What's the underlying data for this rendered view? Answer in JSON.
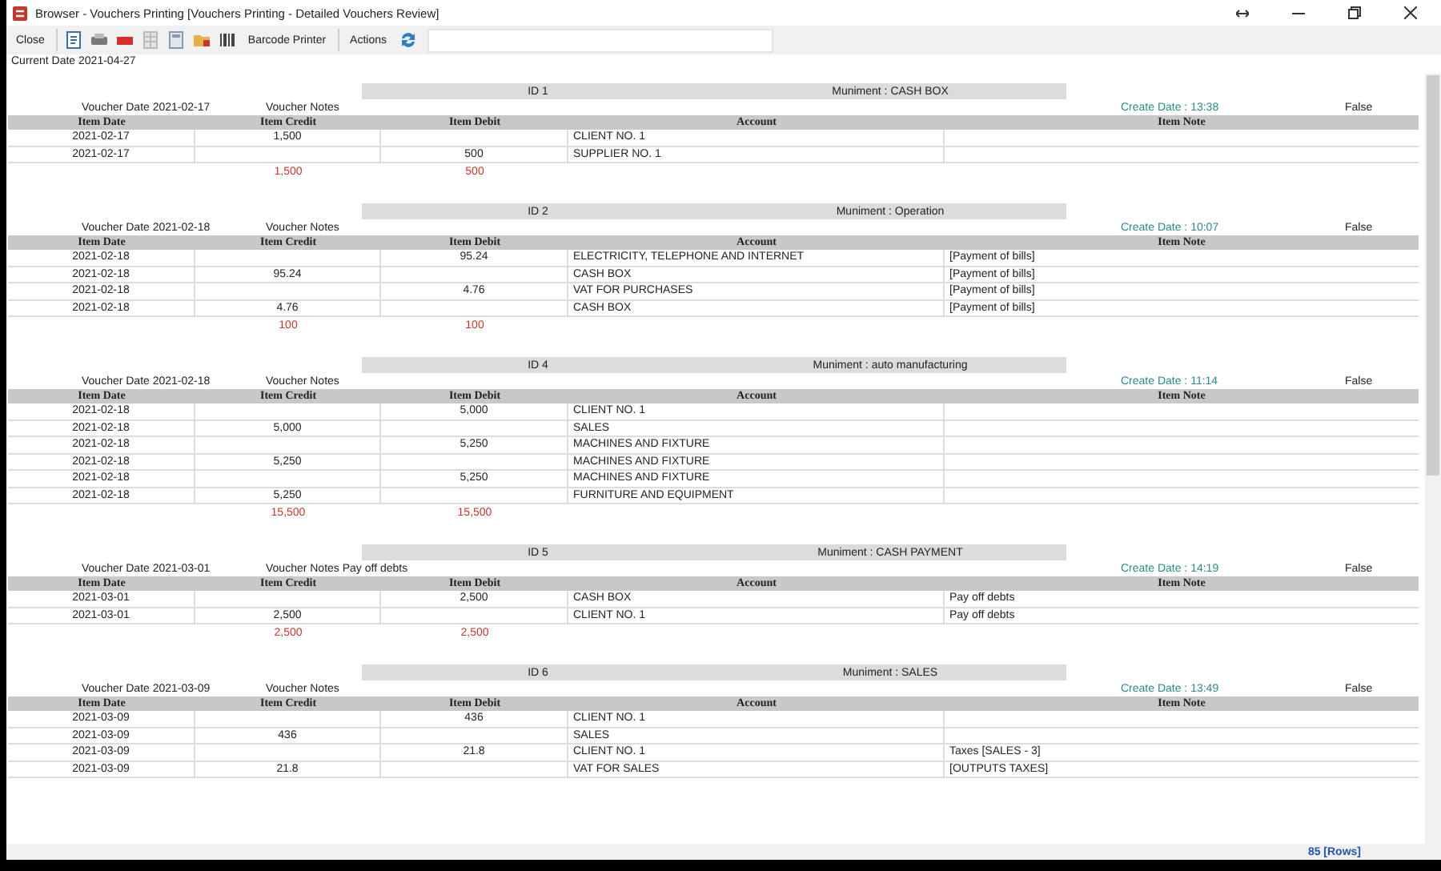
{
  "window": {
    "title": "Browser - Vouchers Printing [Vouchers Printing - Detailed Vouchers Review]"
  },
  "toolbar": {
    "close": "Close",
    "barcode": "Barcode Printer",
    "actions": "Actions"
  },
  "current_date": "Current Date 2021-04-27",
  "vouchers": [
    {
      "id": "ID 1",
      "muniment": "Muniment : CASH BOX",
      "voucher_date": "Voucher Date 2021-02-17",
      "notes": "Voucher Notes",
      "create_date": "Create Date : 13:38",
      "flag": "False",
      "columns": [
        "Item Date",
        "Item Credit",
        "Item Debit",
        "Account",
        "Item Note"
      ],
      "rows": [
        {
          "date": "2021-02-17",
          "credit": "1,500",
          "account": "CLIENT NO. 1"
        },
        {
          "date": "2021-02-17",
          "debit": "500",
          "account": "SUPPLIER NO. 1"
        }
      ],
      "totals": {
        "credit": "1,500",
        "debit": "500"
      }
    },
    {
      "id": "ID 2",
      "muniment": "Muniment : Operation",
      "voucher_date": "Voucher Date 2021-02-18",
      "notes": "Voucher Notes",
      "create_date": "Create Date : 10:07",
      "flag": "False",
      "columns": [
        "Item Date",
        "Item Credit",
        "Item Debit",
        "Account",
        "Item Note"
      ],
      "rows": [
        {
          "date": "2021-02-18",
          "debit": "95.24",
          "account": "ELECTRICITY, TELEPHONE AND INTERNET",
          "note": "[Payment of bills]"
        },
        {
          "date": "2021-02-18",
          "credit": "95.24",
          "account": "CASH BOX",
          "note": "[Payment of bills]"
        },
        {
          "date": "2021-02-18",
          "debit": "4.76",
          "account": "VAT FOR PURCHASES",
          "note": "[Payment of bills]"
        },
        {
          "date": "2021-02-18",
          "credit": "4.76",
          "account": "CASH BOX",
          "note": "[Payment of bills]"
        }
      ],
      "totals": {
        "credit": "100",
        "debit": "100"
      }
    },
    {
      "id": "ID 4",
      "muniment": "Muniment : auto manufacturing",
      "voucher_date": "Voucher Date 2021-02-18",
      "notes": "Voucher Notes",
      "create_date": "Create Date : 11:14",
      "flag": "False",
      "columns": [
        "Item Date",
        "Item Credit",
        "Item Debit",
        "Account",
        "Item Note"
      ],
      "rows": [
        {
          "date": "2021-02-18",
          "debit": "5,000",
          "account": "CLIENT NO. 1"
        },
        {
          "date": "2021-02-18",
          "credit": "5,000",
          "account": "SALES"
        },
        {
          "date": "2021-02-18",
          "debit": "5,250",
          "account": "MACHINES AND FIXTURE"
        },
        {
          "date": "2021-02-18",
          "credit": "5,250",
          "account": "MACHINES AND FIXTURE"
        },
        {
          "date": "2021-02-18",
          "debit": "5,250",
          "account": "MACHINES AND FIXTURE"
        },
        {
          "date": "2021-02-18",
          "credit": "5,250",
          "account": "FURNITURE AND EQUIPMENT"
        }
      ],
      "totals": {
        "credit": "15,500",
        "debit": "15,500"
      }
    },
    {
      "id": "ID 5",
      "muniment": "Muniment : CASH PAYMENT",
      "voucher_date": "Voucher Date 2021-03-01",
      "notes": "Voucher Notes Pay off debts",
      "create_date": "Create Date : 14:19",
      "flag": "False",
      "columns": [
        "Item Date",
        "Item Credit",
        "Item Debit",
        "Account",
        "Item Note"
      ],
      "rows": [
        {
          "date": "2021-03-01",
          "debit": "2,500",
          "account": "CASH BOX",
          "note": "Pay off debts"
        },
        {
          "date": "2021-03-01",
          "credit": "2,500",
          "account": "CLIENT NO. 1",
          "note": "Pay off debts"
        }
      ],
      "totals": {
        "credit": "2,500",
        "debit": "2,500"
      }
    },
    {
      "id": "ID 6",
      "muniment": "Muniment : SALES",
      "voucher_date": "Voucher Date 2021-03-09",
      "notes": "Voucher Notes",
      "create_date": "Create Date : 13:49",
      "flag": "False",
      "columns": [
        "Item Date",
        "Item Credit",
        "Item Debit",
        "Account",
        "Item Note"
      ],
      "rows": [
        {
          "date": "2021-03-09",
          "debit": "436",
          "account": "CLIENT NO. 1"
        },
        {
          "date": "2021-03-09",
          "credit": "436",
          "account": "SALES"
        },
        {
          "date": "2021-03-09",
          "debit": "21.8",
          "account": "CLIENT NO. 1",
          "note": "Taxes [SALES - 3]"
        },
        {
          "date": "2021-03-09",
          "credit": "21.8",
          "account": "VAT FOR SALES",
          "note": "[OUTPUTS TAXES]"
        }
      ]
    }
  ],
  "status_bar": {
    "rows": "85 [Rows]"
  }
}
